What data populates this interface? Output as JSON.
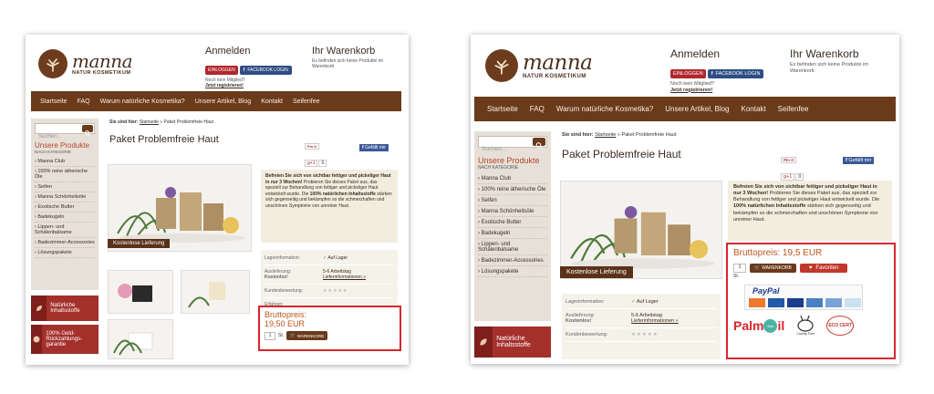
{
  "brand": {
    "name": "manna",
    "sub": "NATUR KOSMETIKUM"
  },
  "login": {
    "title": "Anmelden",
    "login_btn": "EINLOGGEN",
    "fb_btn": "FACEBOOK LOGIN",
    "not_member": "Noch kein Mitglied?",
    "register": "Jetzt registrieren!"
  },
  "cart": {
    "title": "Ihr Warenkorb",
    "text": "Es befinden sich keine Produkte im Warenkorb"
  },
  "nav": [
    "Startseite",
    "FAQ",
    "Warum natürliche Kosmetika?",
    "Unsere Artikel, Blog",
    "Kontakt",
    "Seifenfee"
  ],
  "search": {
    "placeholder": "Suchen..."
  },
  "categories": {
    "title": "Unsere Produkte",
    "sub": "NACH KATEGORIE",
    "items": [
      "Manna Club",
      "100% reine ätherische Öle",
      "Seifen",
      "Manna Schönheitsöle",
      "Exotische Butter",
      "Badekugeln",
      "Lippen- und Schälenbalsame",
      "Badezimmer-Accessories",
      "Lösungspakete"
    ]
  },
  "side_badges": [
    "Natürliche Inhaltsstoffe",
    "100% Geld-Rückzahlungs-garantie"
  ],
  "breadcrumb": {
    "label": "Sie sind hier:",
    "home": "Startseite",
    "sep": " » ",
    "current": "Paket Problemfreie Haut"
  },
  "product": {
    "title": "Paket Problemfreie Haut",
    "delivery_badge": "Kostenlose Lieferung",
    "desc_bold": "Befreien Sie sich von sichtbar fettiger und pickeliger Haut in nur 3 Wochen!",
    "desc_text": " Probieren Sie dieses Paket aus, das speziell zur Behandlung von fettiger und pickeliger Haut entwickelt wurde. Die ",
    "desc_bold2": "100% natürlichen Inhaltsstoffe",
    "desc_text2": " stärken sich gegenseitig und bekämpfen so die schmerzhaften und unschönen Symptome von unreiner Haut."
  },
  "social": {
    "pin": "Pin it",
    "gplus": "g+1",
    "count": "0",
    "fb": "Gefällt mir"
  },
  "info": {
    "stock_label": "Lagerinformation:",
    "stock_value": "Auf Lager",
    "delivery_label": "Auslieferung:",
    "delivery_free": "Kostenlos!",
    "delivery_value": "5-6 Arbeitstag",
    "delivery_link": "Lieferinformationen »",
    "rating_label": "Kundenbewertung:",
    "rating": 0,
    "stars": "★★★★★",
    "extra_label": "Erfahren:"
  },
  "price_left": {
    "label": "Bruttopreis:",
    "value": "19,50 EUR",
    "qty": "1",
    "unit": "St.",
    "cart_btn": "WARENKORB"
  },
  "price_right": {
    "label": "Bruttopreis: 19,5 EUR",
    "qty": "1",
    "unit": "St.",
    "cart_btn": "WARENKORB",
    "fav_btn": "Favoriten"
  },
  "payment": {
    "paypal": "PayPal",
    "palm": "Palm",
    "palm2": "il",
    "palm_free": "free",
    "cruelty": "Cruelty-Free",
    "ecocert": "ECO CERT"
  },
  "colors": {
    "brown": "#6a3a1b",
    "red": "#d8262d",
    "accent": "#c0541e"
  }
}
